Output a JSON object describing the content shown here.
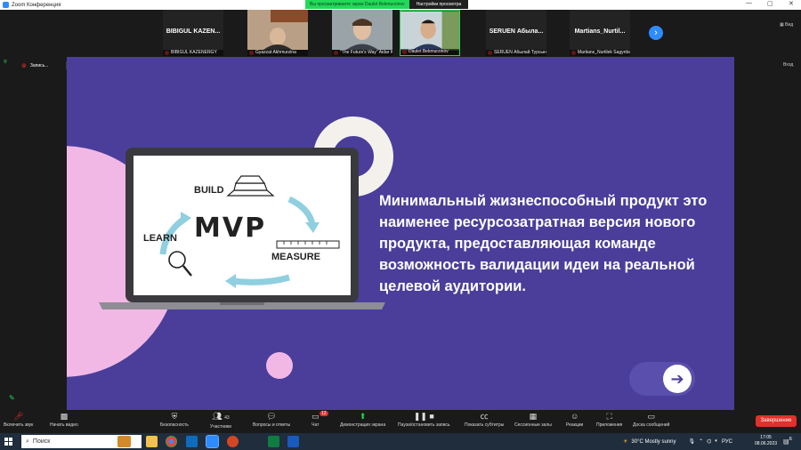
{
  "window": {
    "title": "Zoom Конференция"
  },
  "share_banner": {
    "viewing": "Вы просматриваете экран Daulet Bekmurzinov",
    "settings": "Настройки просмотра"
  },
  "participants": [
    {
      "tile_name": "BIBIGUL KAZEN...",
      "caption": "BIBIGUL KAZENERGY"
    },
    {
      "tile_name": "",
      "caption": "Gyazzat Akhmurzina"
    },
    {
      "tile_name": "",
      "caption": "\"The Future's Way\" Aidar K..."
    },
    {
      "tile_name": "",
      "caption": "Daulet Bekmurzinov"
    },
    {
      "tile_name": "SERUEN Абыла...",
      "caption": "SERUEN Абылай Турсынбек"
    },
    {
      "tile_name": "Martians_Nurtil...",
      "caption": "Martians_Nurtilek Sagynba..."
    }
  ],
  "top_right": {
    "view": "Вид",
    "enter": "Вход"
  },
  "recording": {
    "label": "Запись..."
  },
  "slide": {
    "text": "Минимальный жизнеспособный продукт это наименее ресурсозатратная версия нового продукта, предоставляющая команде возможность валидации идеи на реальной целевой аудитории.",
    "diagram": {
      "center": "MVP",
      "build": "BUILD",
      "measure": "MEASURE",
      "learn": "LEARN"
    }
  },
  "toolbar": {
    "audio": "Включить звук",
    "video": "Начать видео",
    "security": "Безопасность",
    "participants": "Участники",
    "participants_count": "43",
    "qa": "Вопросы и ответы",
    "chat": "Чат",
    "chat_badge": "12",
    "share": "Демонстрация экрана",
    "pause_record": "Пауза/остановить запись",
    "captions": "Показать субтитры",
    "breakout": "Сессионные залы",
    "reactions": "Реакции",
    "apps": "Приложения",
    "whiteboard": "Доска сообщений",
    "end": "Завершение"
  },
  "taskbar": {
    "search": "Поиск",
    "weather": "30°C  Mostly sunny",
    "lang": "РУС",
    "time": "17:05",
    "date": "08.06.2023",
    "notifications": "6"
  },
  "colors": {
    "slide_bg": "#4a3e9a",
    "zoom_blue": "#2d8cff",
    "share_green": "#23d959",
    "end_red": "#e0312b",
    "pink": "#f1b8e6"
  }
}
